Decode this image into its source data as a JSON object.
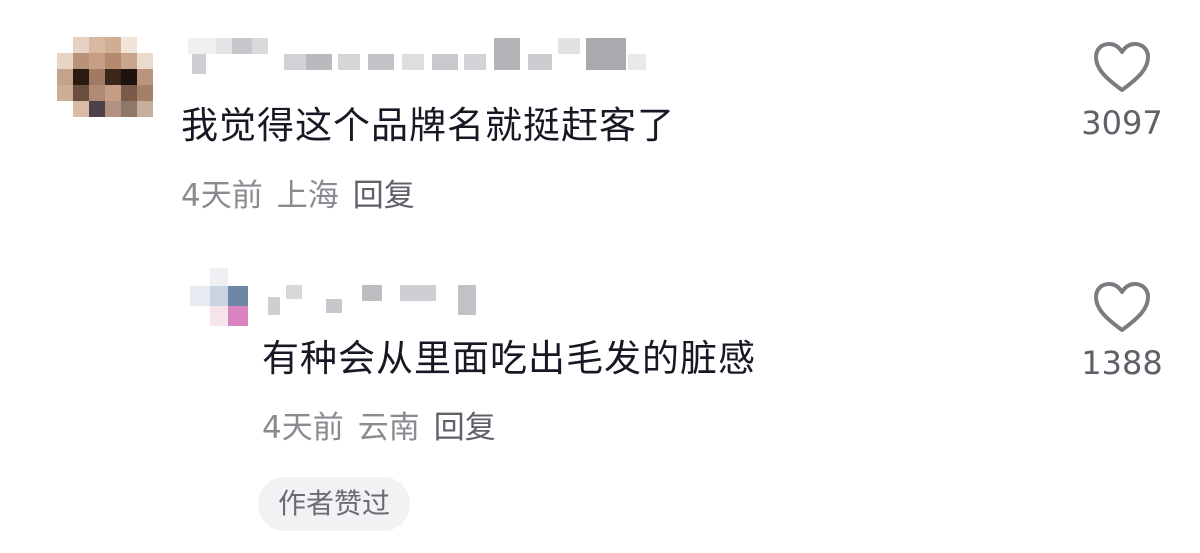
{
  "comments": [
    {
      "text": "我觉得这个品牌名就挺赶客了",
      "time": "4天前",
      "location": "上海",
      "reply_label": "回复",
      "likes": "3097"
    },
    {
      "text": "有种会从里面吃出毛发的脏感",
      "time": "4天前",
      "location": "云南",
      "reply_label": "回复",
      "likes": "1388",
      "author_liked": "作者赞过"
    }
  ],
  "icons": {
    "like": "heart-outline-icon"
  },
  "colors": {
    "text": "#161823",
    "meta": "#8a8b91",
    "heart": "#7b7c82",
    "pill_bg": "#f2f2f4"
  }
}
